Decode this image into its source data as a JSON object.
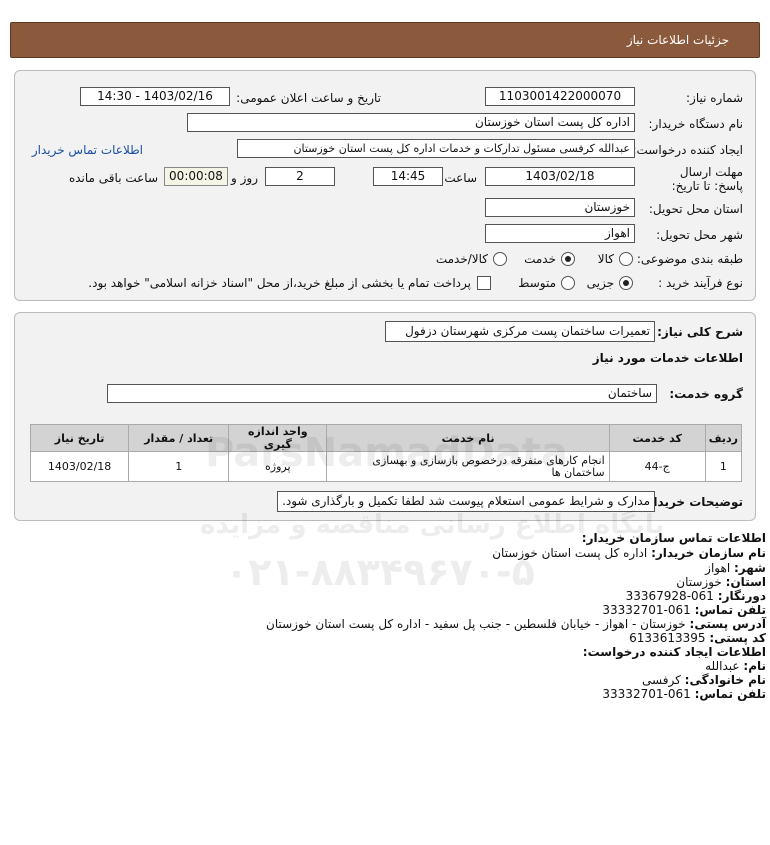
{
  "header": {
    "title": "جزئیات اطلاعات نیاز"
  },
  "form": {
    "need_number_label": "شماره نیاز:",
    "need_number": "1103001422000070",
    "announce_label": "تاریخ و ساعت اعلان عمومی:",
    "announce_value": "1403/02/16 - 14:30",
    "buyer_org_label": "نام دستگاه خریدار:",
    "buyer_org": "اداره کل پست استان خوزستان",
    "creator_label": "ایجاد کننده درخواست:",
    "creator": "عبدالله کرفسی مسئول تدارکات و خدمات اداره کل پست استان خوزستان",
    "contact_link": "اطلاعات تماس خریدار",
    "deadline_label": "مهلت ارسال پاسخ: تا تاریخ:",
    "deadline_date": "1403/02/18",
    "time_label": "ساعت",
    "deadline_time": "14:45",
    "days_value": "2",
    "days_label": "روز و",
    "remaining_value": "00:00:08",
    "remaining_label": "ساعت باقی مانده",
    "province_label": "استان محل تحویل:",
    "province": "خوزستان",
    "city_label": "شهر محل تحویل:",
    "city": "اهواز",
    "category_label": "طبقه بندی موضوعی:",
    "category_options": [
      "کالا",
      "خدمت",
      "کالا/خدمت"
    ],
    "category_selected": "خدمت",
    "process_label": "نوع فرآیند خرید :",
    "process_options": [
      "جزیی",
      "متوسط"
    ],
    "process_selected": "جزیی",
    "payment_note": "پرداخت تمام یا بخشی از مبلغ خرید،از محل \"اسناد خزانه اسلامی\" خواهد بود."
  },
  "details": {
    "summary_label": "شرح کلی نیاز:",
    "summary": "تعمیرات ساختمان پست مرکزی شهرستان دزفول",
    "services_heading": "اطلاعات خدمات مورد نیاز",
    "service_group_label": "گروه خدمت:",
    "service_group": "ساختمان",
    "table": {
      "headers": [
        "ردیف",
        "کد خدمت",
        "نام خدمت",
        "واحد اندازه گیری",
        "تعداد / مقدار",
        "تاریخ نیاز"
      ],
      "rows": [
        [
          "1",
          "ج-44",
          "انجام کارهای متفرقه درخصوص بازسازی و بهسازی ساختمان ها",
          "پروژه",
          "1",
          "1403/02/18"
        ]
      ]
    },
    "buyer_notes_label": "توضیحات خریدار:",
    "buyer_notes": "مدارک و شرایط عمومی استعلام پیوست شد لطفا تکمیل و بارگذاری شود."
  },
  "contact": {
    "heading": "اطلاعات تماس سازمان خریدار:",
    "org_label": "نام سازمان خریدار:",
    "org": "اداره کل پست استان خوزستان",
    "city_label": "شهر:",
    "city": "اهواز",
    "province_label": "استان:",
    "province": "خوزستان",
    "fax_label": "دورنگار:",
    "fax": "061-33367928",
    "phone_label": "تلفن تماس:",
    "phone": "061-33332701",
    "address_label": "آدرس پستی:",
    "address": "خوزستان - اهواز - خیابان فلسطین - جنب پل سفید - اداره کل پست استان خوزستان",
    "postal_label": "کد پستی:",
    "postal": "6133613395",
    "creator_heading": "اطلاعات ایجاد کننده درخواست:",
    "name_label": "نام:",
    "name": "عبدالله",
    "family_label": "نام خانوادگی:",
    "family": "کرفسی",
    "creator_phone_label": "تلفن تماس:",
    "creator_phone": "061-33332701"
  },
  "watermark": {
    "brand": "ParsNamadData",
    "tagline": "پایگاه اطلاع رسانی مناقصه و مزایده",
    "phone": "۰۲۱-۸۸۳۴۹۶۷۰-۵"
  }
}
